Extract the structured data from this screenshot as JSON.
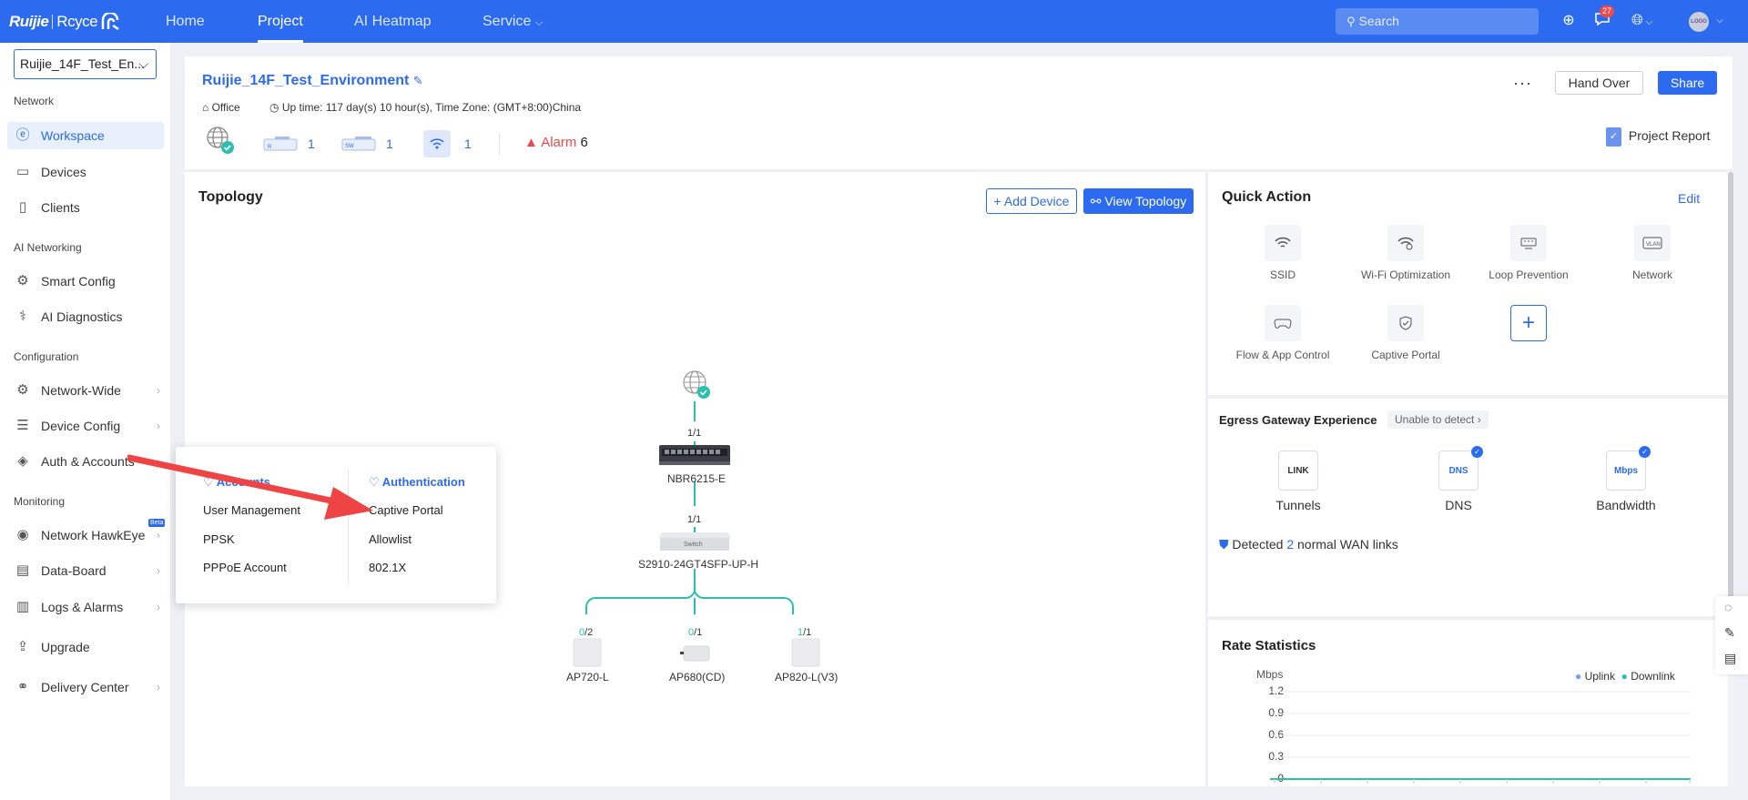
{
  "brand": {
    "logo_text": "Ruijie",
    "logo_text2": "Rcyce"
  },
  "topnav": {
    "items": [
      {
        "label": "Home"
      },
      {
        "label": "Project"
      },
      {
        "label": "AI Heatmap"
      },
      {
        "label": "Service"
      }
    ],
    "search_placeholder": "Search",
    "notification_count": "27",
    "avatar_text": "LOGO"
  },
  "sidebar": {
    "project": "Ruijie_14F_Test_En...",
    "groups": {
      "network": "Network",
      "ai_networking": "AI Networking",
      "configuration": "Configuration",
      "monitoring": "Monitoring"
    },
    "items": {
      "workspace": "Workspace",
      "devices": "Devices",
      "clients": "Clients",
      "smart_config": "Smart Config",
      "ai_diagnostics": "AI Diagnostics",
      "network_wide": "Network-Wide",
      "device_config": "Device Config",
      "auth_accounts": "Auth & Accounts",
      "network_hawkeye": "Network HawkEye",
      "data_board": "Data-Board",
      "logs_alarms": "Logs & Alarms",
      "upgrade": "Upgrade",
      "delivery_center": "Delivery Center"
    },
    "beta": "Beta"
  },
  "header": {
    "project_name": "Ruijie_14F_Test_Environment",
    "scene": "Office",
    "uptime": "Up time: 117 day(s) 10 hour(s), Time Zone: (GMT+8:00)China",
    "counts": {
      "router": "1",
      "switch": "1",
      "ap": "1"
    },
    "alarm_label": "Alarm",
    "alarm_count": "6",
    "hand_over": "Hand Over",
    "share": "Share",
    "project_report": "Project Report"
  },
  "topology": {
    "title": "Topology",
    "add_device": "Add Device",
    "view_topology": "View Topology",
    "gateway": {
      "name": "NBR6215-E",
      "port": "1/1"
    },
    "switch": {
      "name": "S2910-24GT4SFP-UP-H",
      "port": "1/1",
      "face_label": "Switch"
    },
    "aps": [
      {
        "name": "AP720-L",
        "port_used": "0",
        "port_total": "/2"
      },
      {
        "name": "AP680(CD)",
        "port_used": "0",
        "port_total": "/1"
      },
      {
        "name": "AP820-L(V3)",
        "port_used": "1",
        "port_total": "/1"
      }
    ]
  },
  "popup": {
    "left_header": "Accounts",
    "right_header": "Authentication",
    "left_items": [
      "User Management",
      "PPSK",
      "PPPoE Account"
    ],
    "right_items": [
      "Captive Portal",
      "Allowlist",
      "802.1X"
    ]
  },
  "quick_action": {
    "title": "Quick Action",
    "edit": "Edit",
    "items": [
      "SSID",
      "Wi-Fi Optimization",
      "Loop Prevention",
      "Network",
      "Flow & App Control",
      "Captive Portal"
    ]
  },
  "egress": {
    "title": "Egress Gateway Experience",
    "status": "Unable to detect",
    "items": [
      {
        "label": "Tunnels",
        "icon_text": "LINK"
      },
      {
        "label": "DNS",
        "icon_text": "DNS"
      },
      {
        "label": "Bandwidth",
        "icon_text": "Mbps"
      }
    ],
    "detected_prefix": "Detected ",
    "detected_count": "2",
    "detected_suffix": " normal WAN links"
  },
  "rate": {
    "title": "Rate Statistics",
    "unit": "Mbps",
    "legend_uplink": "Uplink",
    "legend_downlink": "Downlink",
    "yticks": [
      "1.2",
      "0.9",
      "0.6",
      "0.3",
      "0"
    ]
  },
  "colors": {
    "accent": "#2c6bf0",
    "teal": "#2bbfb0",
    "alarm": "#f04848",
    "arrow": "#ee4444"
  }
}
